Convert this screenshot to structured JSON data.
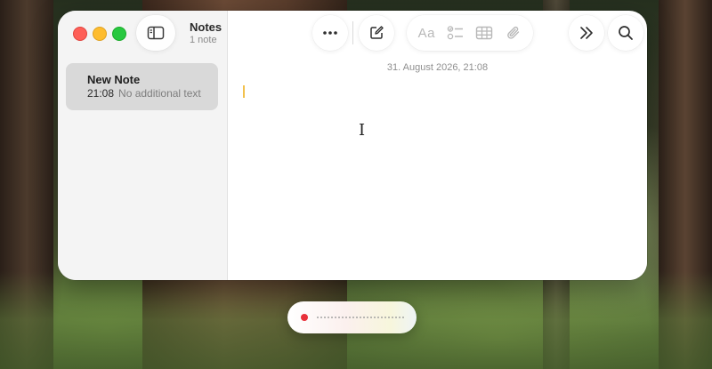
{
  "app": {
    "title": "Notes",
    "note_count": "1 note"
  },
  "toolbar": {
    "buttons": [
      "sidebar-toggle",
      "more",
      "new-note",
      "format",
      "checklist",
      "table",
      "attachment",
      "more-tools",
      "search"
    ],
    "format_label": "Aa"
  },
  "sidebar": {
    "notes": [
      {
        "title": "New Note",
        "time": "21:08",
        "preview": "No additional text"
      }
    ]
  },
  "editor": {
    "date": "31. August 2026, 21:08",
    "body": ""
  },
  "dictation": {
    "state": "recording"
  },
  "colors": {
    "close": "#fe5f57",
    "minimize": "#febc2e",
    "maximize": "#28c840",
    "caret": "#f2c14e",
    "record": "#e8303a",
    "selected_note": "#d9d9d9"
  }
}
